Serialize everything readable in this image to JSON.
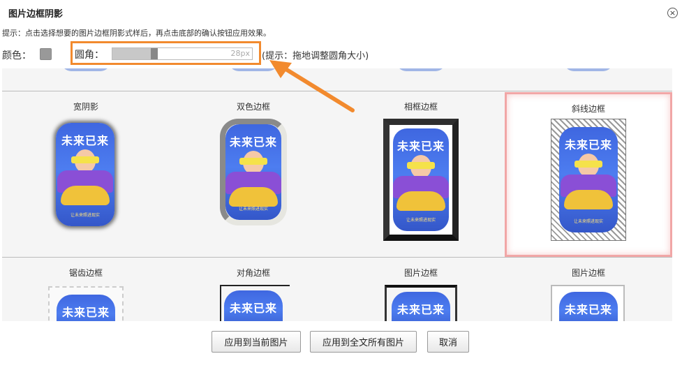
{
  "dialog": {
    "title": "图片边框阴影",
    "close_symbol": "×",
    "hint": "提示：点击选择想要的图片边框阴影式样后，再点击底部的确认按钮应用效果。"
  },
  "controls": {
    "color_label": "颜色：",
    "color_value": "#999999",
    "radius_label": "圆角：",
    "radius_value": "28px",
    "radius_fraction": 0.3,
    "radius_hint": "(提示：拖地调整圆角大小)"
  },
  "poster": {
    "title": "未来已来",
    "tagline": "让未来照进现实"
  },
  "styles_row1": [
    {
      "label": "宽阴影"
    },
    {
      "label": "双色边框"
    },
    {
      "label": "相框边框"
    },
    {
      "label": "斜线边框",
      "selected": true
    }
  ],
  "styles_row2": [
    {
      "label": "锯齿边框"
    },
    {
      "label": "对角边框"
    },
    {
      "label": "图片边框"
    },
    {
      "label": "图片边框"
    }
  ],
  "buttons": {
    "apply_current": "应用到当前图片",
    "apply_all": "应用到全文所有图片",
    "cancel": "取消"
  },
  "colors": {
    "highlight": "#f28a2e",
    "selected_border": "#f1a6a6"
  }
}
